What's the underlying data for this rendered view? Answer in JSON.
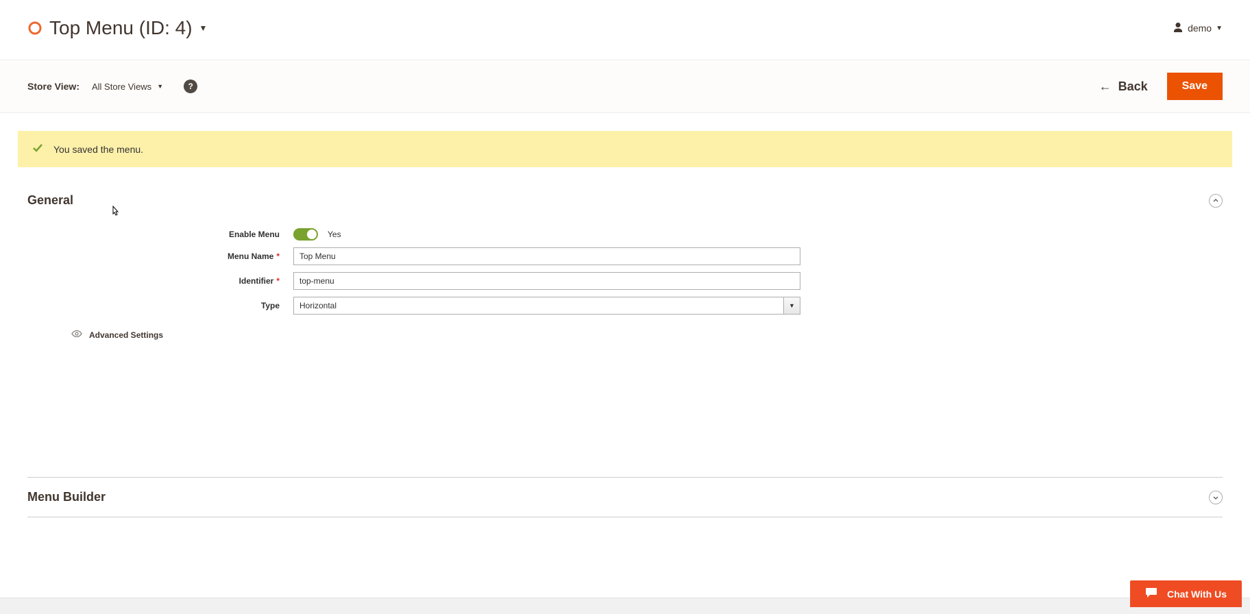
{
  "header": {
    "title": "Top Menu (ID: 4)",
    "user_name": "demo"
  },
  "toolbar": {
    "store_view_label": "Store View:",
    "store_view_value": "All Store Views",
    "back_label": "Back",
    "save_label": "Save"
  },
  "notice": {
    "message": "You saved the menu."
  },
  "general": {
    "title": "General",
    "enable_menu_label": "Enable Menu",
    "enable_menu_value": "Yes",
    "menu_name_label": "Menu Name",
    "menu_name_value": "Top Menu",
    "identifier_label": "Identifier",
    "identifier_value": "top-menu",
    "type_label": "Type",
    "type_value": "Horizontal",
    "advanced_label": "Advanced Settings"
  },
  "menu_builder": {
    "title": "Menu Builder"
  },
  "chat": {
    "label": "Chat With Us"
  }
}
